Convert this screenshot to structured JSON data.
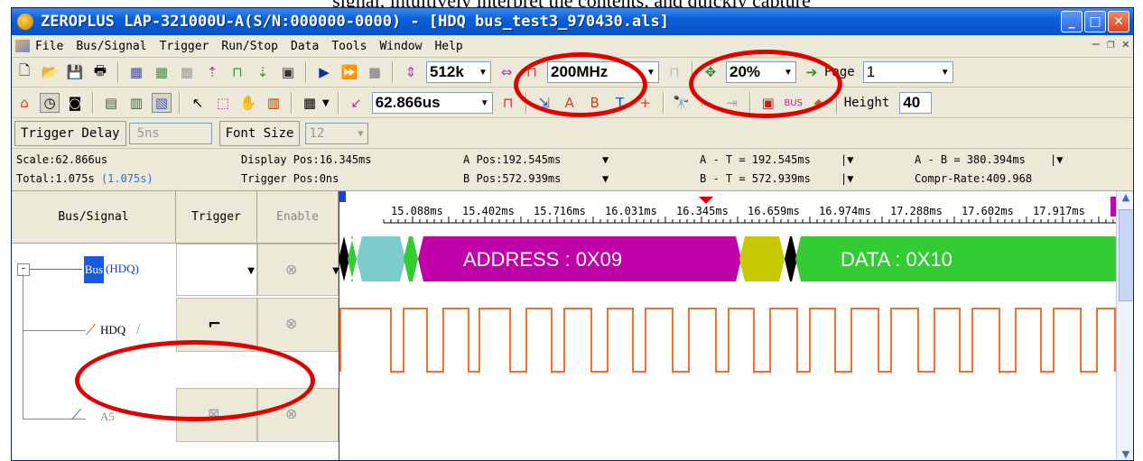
{
  "caption": "signal, intuitively interpret the contents, and quickly capture",
  "window": {
    "title": "ZEROPLUS LAP-321000U-A(S/N:000000-0000) - [HDQ bus_test3_970430.als]"
  },
  "menu": [
    "File",
    "Bus/Signal",
    "Trigger",
    "Run/Stop",
    "Data",
    "Tools",
    "Window",
    "Help"
  ],
  "toolbar1": {
    "memory_depth": "512k",
    "sample_rate": "200MHz",
    "zoom": "20%",
    "page_label": "Page",
    "page_value": "1"
  },
  "toolbar2": {
    "scale": "62.866us",
    "height_label": "Height",
    "height_value": "40"
  },
  "toolbar3": {
    "trigger_delay_label": "Trigger Delay",
    "trigger_delay_value": "5ns",
    "font_size_label": "Font Size",
    "font_size_value": "12"
  },
  "info": {
    "scale": "Scale:62.866us",
    "total": "Total:1.075s",
    "total_paren": "(1.075s)",
    "display_pos": "Display Pos:16.345ms",
    "trigger_pos": "Trigger Pos:0ns",
    "a_pos": "A Pos:192.545ms",
    "b_pos": "B Pos:572.939ms",
    "a_minus_t": "A - T = 192.545ms",
    "b_minus_t": "B - T = 572.939ms",
    "a_minus_b": "A - B = 380.394ms",
    "compr_rate": "Compr-Rate:409.968"
  },
  "grid": {
    "headers": {
      "bus_signal": "Bus/Signal",
      "trigger": "Trigger",
      "enable": "Enable"
    },
    "rows": [
      {
        "name": "Bus",
        "sub": "(HDQ)"
      },
      {
        "name": "HDQ"
      },
      {
        "name": "A5"
      }
    ],
    "time_ticks": [
      "15.088ms",
      "15.402ms",
      "15.716ms",
      "16.031ms",
      "16.345ms",
      "16.659ms",
      "16.974ms",
      "17.288ms",
      "17.602ms",
      "17.917ms"
    ],
    "bus_segments": {
      "address": "ADDRESS : 0X09",
      "data": "DATA : 0X10"
    }
  },
  "colors": {
    "address": "#c000a8",
    "data": "#33cc33",
    "teal": "#7ccccc",
    "olive": "#c8c800",
    "signal": "#f07030",
    "highlight": "#e00000"
  }
}
